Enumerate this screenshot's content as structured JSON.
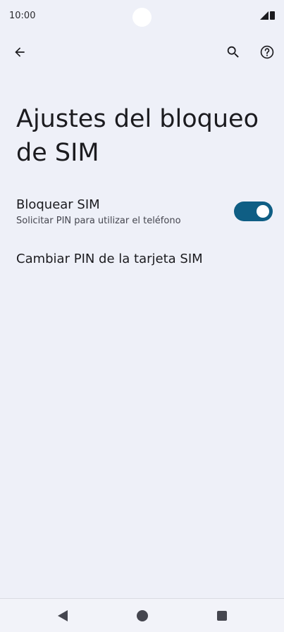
{
  "status_bar": {
    "time": "10:00",
    "icons": [
      "signal-icon",
      "battery-icon"
    ]
  },
  "toolbar": {
    "back_icon": "arrow-back-icon",
    "search_icon": "search-icon",
    "help_icon": "help-icon"
  },
  "page": {
    "title": "Ajustes del bloqueo de SIM"
  },
  "settings": [
    {
      "title": "Bloquear SIM",
      "summary": "Solicitar PIN para utilizar el teléfono",
      "toggle_on": true
    },
    {
      "title": "Cambiar PIN de la tarjeta SIM"
    }
  ],
  "nav_bar": {
    "icons": [
      "nav-back-icon",
      "nav-home-icon",
      "nav-recents-icon"
    ]
  },
  "colors": {
    "background": "#eef0f8",
    "toggle_on": "#0f5e84",
    "text": "#1b1b1f"
  }
}
